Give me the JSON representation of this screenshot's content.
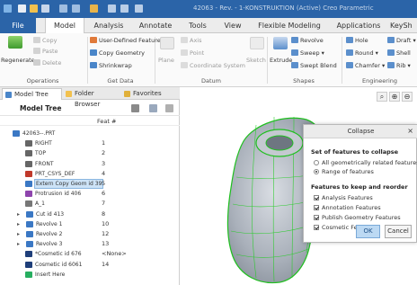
{
  "window": {
    "title": "42063 - Rev. - 1-KONSTRUKTION (Active) Creo Parametric",
    "accent": "#2b64a8"
  },
  "ribbon_tabs": [
    {
      "label": "File"
    },
    {
      "label": "Model"
    },
    {
      "label": "Analysis"
    },
    {
      "label": "Annotate"
    },
    {
      "label": "Tools"
    },
    {
      "label": "View"
    },
    {
      "label": "Flexible Modeling"
    },
    {
      "label": "Applications"
    },
    {
      "label": "KeySh"
    }
  ],
  "ribbon": {
    "regenerate": "Regenerate",
    "copy": "Copy",
    "paste": "Paste",
    "delete": "Delete",
    "user_defined_feature": "User-Defined Feature",
    "copy_geometry": "Copy Geometry",
    "shrinkwrap": "Shrinkwrap",
    "plane": "Plane",
    "axis": "Axis",
    "point": "Point",
    "coordinate_system": "Coordinate System",
    "sketch": "Sketch",
    "extrude": "Extrude",
    "revolve": "Revolve",
    "sweep": "Sweep",
    "swept_blend": "Swept Blend",
    "hole": "Hole",
    "round": "Round",
    "chamfer": "Chamfer",
    "draft": "Draft",
    "shell": "Shell",
    "rib": "Rib",
    "groups": {
      "operations": "Operations",
      "get_data": "Get Data",
      "datum": "Datum",
      "shapes": "Shapes",
      "engineering": "Engineering"
    }
  },
  "panel": {
    "tabs": {
      "model_tree": "Model Tree",
      "folder_browser": "Folder Browser",
      "favorites": "Favorites"
    },
    "title": "Model Tree",
    "feat_col": "Feat #",
    "items": [
      {
        "label": "42063--.PRT",
        "num": "",
        "icon": "part-icon",
        "color": "#3b78c4"
      },
      {
        "label": "RIGHT",
        "num": "1",
        "icon": "datum-plane-icon",
        "color": "#666666"
      },
      {
        "label": "TOP",
        "num": "2",
        "icon": "datum-plane-icon",
        "color": "#666666"
      },
      {
        "label": "FRONT",
        "num": "3",
        "icon": "datum-plane-icon",
        "color": "#666666"
      },
      {
        "label": "PRT_CSYS_DEF",
        "num": "4",
        "icon": "csys-icon",
        "color": "#c0392b"
      },
      {
        "label": "Extern Copy Geom id 39",
        "num": "5",
        "icon": "copy-geom-icon",
        "color": "#3b78c4"
      },
      {
        "label": "Protrusion id 406",
        "num": "6",
        "icon": "protrusion-icon",
        "color": "#8e44ad"
      },
      {
        "label": "A_1",
        "num": "7",
        "icon": "axis-icon",
        "color": "#777777"
      },
      {
        "label": "Cut id 413",
        "num": "8",
        "icon": "cut-icon",
        "color": "#3b78c4"
      },
      {
        "label": "Revolve 1",
        "num": "10",
        "icon": "revolve-icon",
        "color": "#3b78c4"
      },
      {
        "label": "Revolve 2",
        "num": "12",
        "icon": "revolve-icon",
        "color": "#3b78c4"
      },
      {
        "label": "Revolve 3",
        "num": "13",
        "icon": "revolve-icon",
        "color": "#3b78c4"
      },
      {
        "label": "*Cosmetic id 676",
        "num": "<None>",
        "icon": "cosmetic-icon",
        "color": "#1f3f7a"
      },
      {
        "label": "Cosmetic id 6061",
        "num": "14",
        "icon": "cosmetic-icon",
        "color": "#1f3f7a"
      },
      {
        "label": "Insert Here",
        "num": "",
        "icon": "insert-here-icon",
        "color": "#27ae60"
      }
    ]
  },
  "dialog": {
    "title": "Collapse",
    "close": "×",
    "set_heading": "Set of features to collapse",
    "opt_all": "All geometrically related features",
    "opt_range": "Range of features",
    "keep_heading": "Features to keep and reorder",
    "checks": [
      "Analysis Features",
      "Annotation Features",
      "Publish Geometry Features",
      "Cosmetic Features"
    ],
    "ok": "OK",
    "cancel": "Cancel"
  }
}
